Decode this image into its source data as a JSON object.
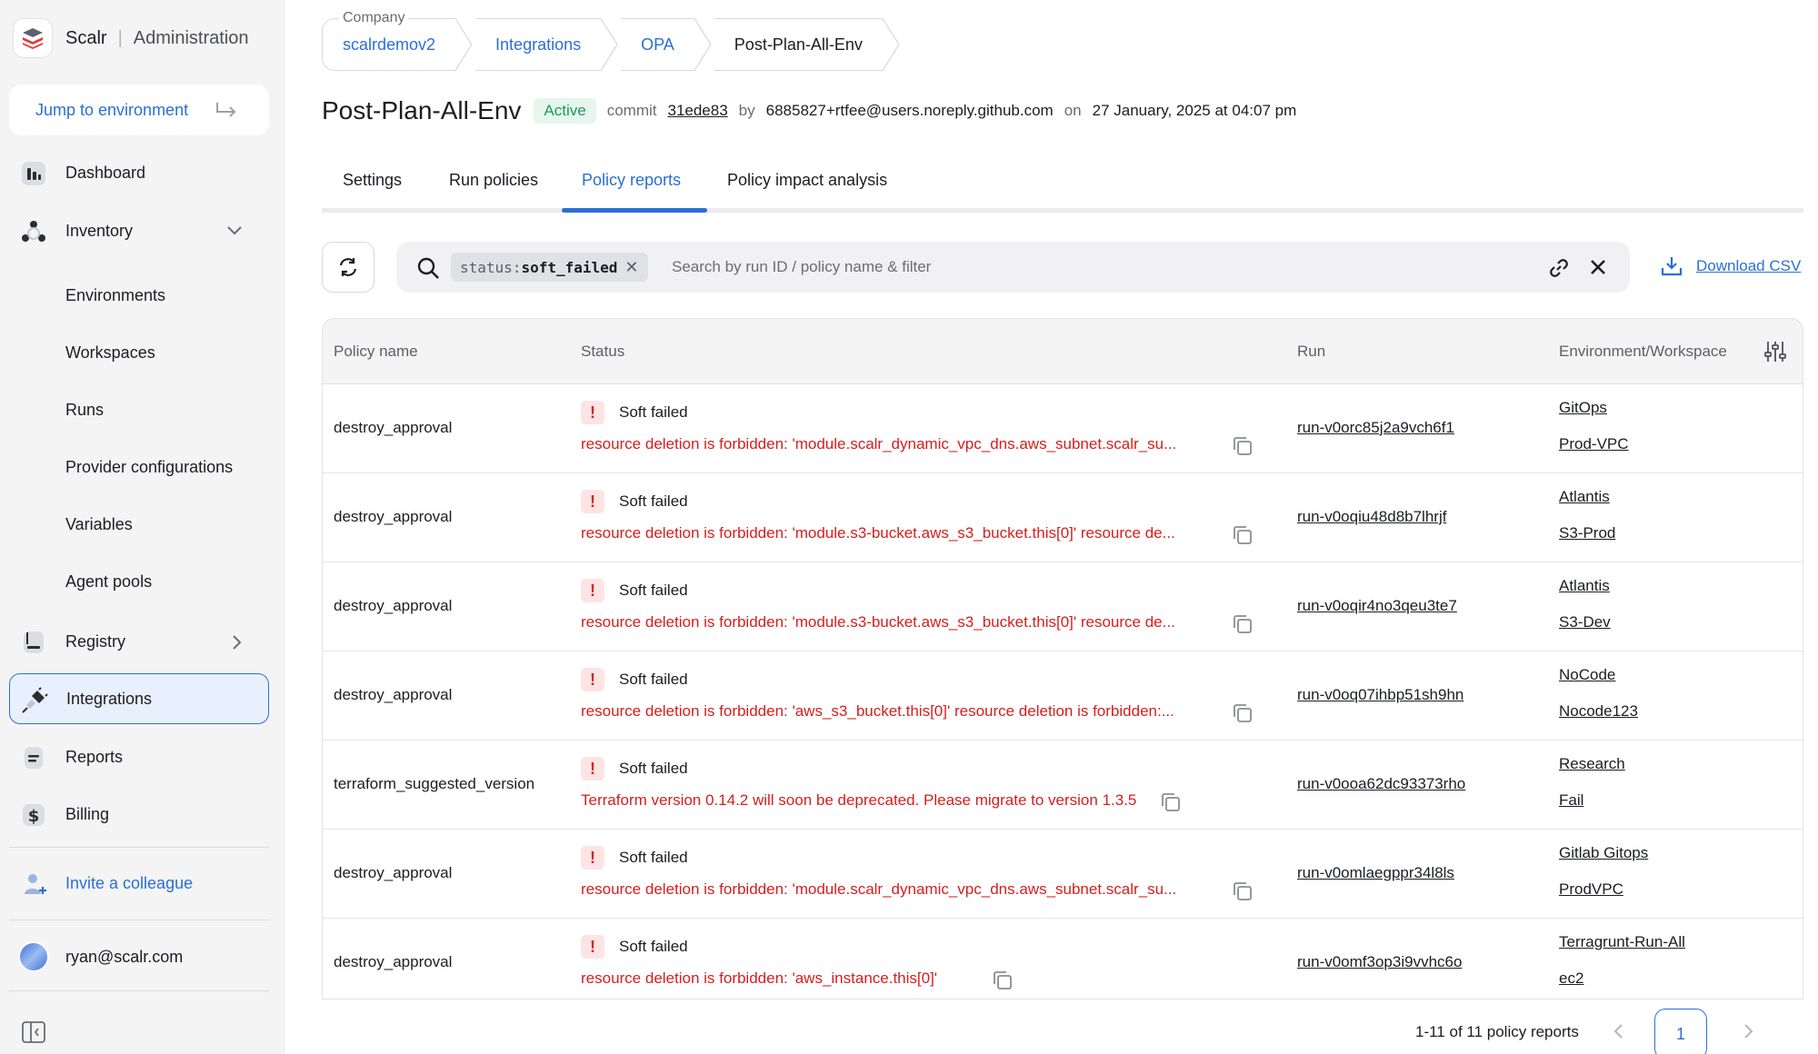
{
  "brand": {
    "name": "Scalr",
    "section": "Administration"
  },
  "sidebar": {
    "jump_label": "Jump to environment",
    "items": [
      {
        "label": "Dashboard"
      },
      {
        "label": "Inventory"
      },
      {
        "label": "Environments"
      },
      {
        "label": "Workspaces"
      },
      {
        "label": "Runs"
      },
      {
        "label": "Provider configurations"
      },
      {
        "label": "Variables"
      },
      {
        "label": "Agent pools"
      },
      {
        "label": "Registry"
      },
      {
        "label": "Integrations"
      },
      {
        "label": "Reports"
      },
      {
        "label": "Billing"
      }
    ],
    "invite_label": "Invite a colleague",
    "user_email": "ryan@scalr.com"
  },
  "breadcrumb": {
    "company_tag": "Company",
    "items": [
      "scalrdemov2",
      "Integrations",
      "OPA",
      "Post-Plan-All-Env"
    ]
  },
  "header": {
    "title": "Post-Plan-All-Env",
    "status": "Active",
    "commit_label": "commit",
    "commit_hash": "31ede83",
    "by_label": "by",
    "author": "6885827+rtfee@users.noreply.github.com",
    "on_label": "on",
    "date": "27 January, 2025 at 04:07 pm"
  },
  "tabs": [
    "Settings",
    "Run policies",
    "Policy reports",
    "Policy impact analysis"
  ],
  "search": {
    "filter_key": "status:",
    "filter_value": "soft_failed",
    "placeholder": "Search by run ID / policy name & filter"
  },
  "download_label": "Download CSV",
  "table": {
    "columns": [
      "Policy name",
      "Status",
      "Run",
      "Environment/Workspace"
    ],
    "rows": [
      {
        "policy": "destroy_approval",
        "status": "Soft failed",
        "message": "resource deletion is forbidden: 'module.scalr_dynamic_vpc_dns.aws_subnet.scalr_su...",
        "run": "run-v0orc85j2a9vch6f1",
        "environment": "GitOps",
        "workspace": "Prod-VPC"
      },
      {
        "policy": "destroy_approval",
        "status": "Soft failed",
        "message": "resource deletion is forbidden: 'module.s3-bucket.aws_s3_bucket.this[0]' resource de...",
        "run": "run-v0oqiu48d8b7lhrjf",
        "environment": "Atlantis",
        "workspace": "S3-Prod"
      },
      {
        "policy": "destroy_approval",
        "status": "Soft failed",
        "message": "resource deletion is forbidden: 'module.s3-bucket.aws_s3_bucket.this[0]' resource de...",
        "run": "run-v0oqir4no3qeu3te7",
        "environment": "Atlantis",
        "workspace": "S3-Dev"
      },
      {
        "policy": "destroy_approval",
        "status": "Soft failed",
        "message": "resource deletion is forbidden: 'aws_s3_bucket.this[0]' resource deletion is forbidden:...",
        "run": "run-v0oq07ihbp51sh9hn",
        "environment": "NoCode",
        "workspace": "Nocode123"
      },
      {
        "policy": "terraform_suggested_version",
        "status": "Soft failed",
        "message": "Terraform version 0.14.2 will soon be deprecated. Please migrate to version 1.3.5",
        "run": "run-v0ooa62dc93373rho",
        "environment": "Research",
        "workspace": "Fail"
      },
      {
        "policy": "destroy_approval",
        "status": "Soft failed",
        "message": "resource deletion is forbidden: 'module.scalr_dynamic_vpc_dns.aws_subnet.scalr_su...",
        "run": "run-v0omlaegppr34l8ls",
        "environment": "Gitlab Gitops",
        "workspace": "ProdVPC"
      },
      {
        "policy": "destroy_approval",
        "status": "Soft failed",
        "message": "resource deletion is forbidden: 'aws_instance.this[0]'",
        "run": "run-v0omf3op3i9vvhc6o",
        "environment": "Terragrunt-Run-All",
        "workspace": "ec2"
      }
    ]
  },
  "pagination": {
    "summary": "1-11 of 11 policy reports",
    "current_page": "1"
  },
  "colors": {
    "accent": "#2b6fd6",
    "error": "#d71d1d",
    "success": "#1c9b5a"
  }
}
